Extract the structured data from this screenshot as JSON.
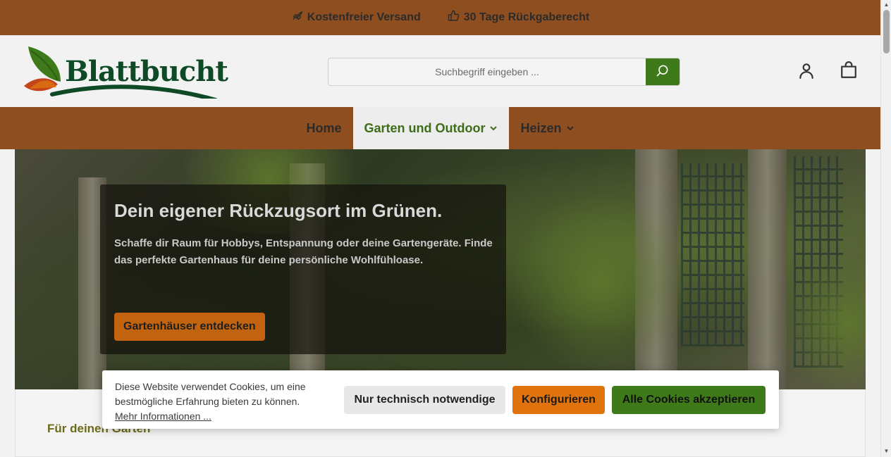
{
  "topbar": {
    "usps": [
      {
        "label": "Kostenfreier Versand",
        "icon": "rocket-icon"
      },
      {
        "label": "30 Tage Rückgaberecht",
        "icon": "thumbs-up-icon"
      }
    ],
    "bg_color": "#8f4e1f"
  },
  "header": {
    "logo_text": "Blattbucht",
    "search": {
      "placeholder": "Suchbegriff eingeben ..."
    },
    "icons": [
      "search-icon",
      "account-icon",
      "cart-icon"
    ]
  },
  "nav": {
    "items": [
      {
        "label": "Home",
        "active": false,
        "dropdown": false
      },
      {
        "label": "Garten und Outdoor",
        "active": true,
        "dropdown": true
      },
      {
        "label": "Heizen",
        "active": false,
        "dropdown": true
      }
    ]
  },
  "hero": {
    "title": "Dein eigener Rückzugsort im Grünen.",
    "subtitle": "Schaffe dir Raum für Hobbys, Entspannung oder deine Gartengeräte. Finde das perfekte Gartenhaus für deine persönliche Wohlfühloase.",
    "button": "Gartenhäuser entdecken"
  },
  "content": {
    "heading": "Für deinen Garten"
  },
  "cookie": {
    "text": "Diese Website verwendet Cookies, um eine bestmögliche Erfahrung bieten zu können.",
    "link": "Mehr Informationen ...",
    "buttons": {
      "necessary": "Nur technisch notwendige",
      "configure": "Konfigurieren",
      "accept": "Alle Cookies akzeptieren"
    }
  },
  "colors": {
    "brand_brown": "#8f4e1f",
    "brand_green": "#3f7a1a",
    "accent_orange": "#e0730e"
  }
}
